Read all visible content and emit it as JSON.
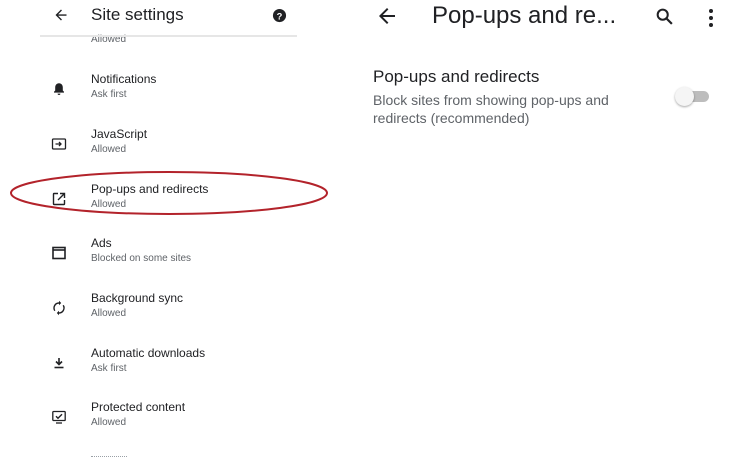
{
  "left": {
    "header": {
      "title": "Site settings",
      "back_icon": "arrow-back-icon",
      "help_icon": "help-icon"
    },
    "partial_item_status": "Allowed",
    "items": [
      {
        "title": "Notifications",
        "subtitle": "Ask first",
        "icon": "bell-icon"
      },
      {
        "title": "JavaScript",
        "subtitle": "Allowed",
        "icon": "javascript-icon"
      },
      {
        "title": "Pop-ups and redirects",
        "subtitle": "Allowed",
        "icon": "open-in-new-icon",
        "highlighted": true
      },
      {
        "title": "Ads",
        "subtitle": "Blocked on some sites",
        "icon": "ads-icon"
      },
      {
        "title": "Background sync",
        "subtitle": "Allowed",
        "icon": "sync-icon"
      },
      {
        "title": "Automatic downloads",
        "subtitle": "Ask first",
        "icon": "download-icon"
      },
      {
        "title": "Protected content",
        "subtitle": "Allowed",
        "icon": "protected-content-icon"
      }
    ],
    "highlight_color": "#b3232b"
  },
  "right": {
    "header": {
      "title": "Pop-ups and re...",
      "back_icon": "arrow-back-icon",
      "search_icon": "search-icon",
      "more_icon": "more-vert-icon"
    },
    "setting": {
      "title": "Pop-ups and redirects",
      "description": "Block sites from showing pop-ups and redirects (recommended)",
      "toggle_on": false
    }
  }
}
